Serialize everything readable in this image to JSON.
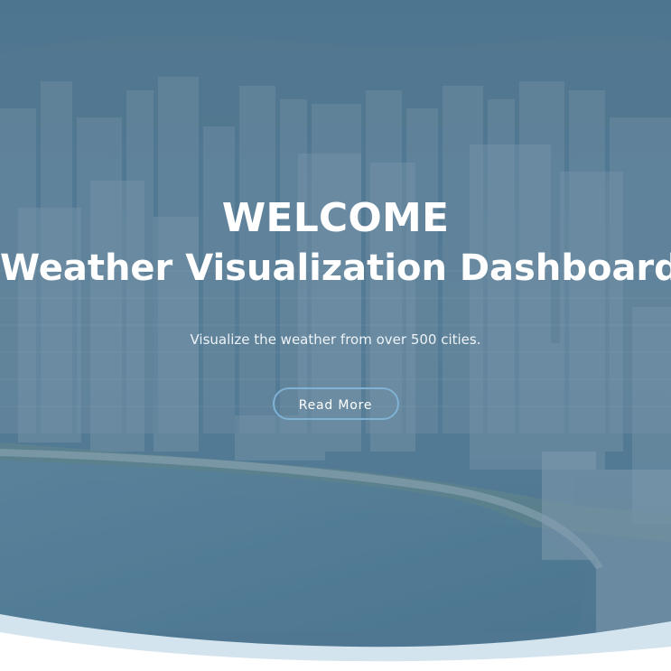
{
  "hero": {
    "title_line1": "WELCOME",
    "title_line2": "Weather Visualization Dashboard",
    "subtitle": "Visualize the weather from over 500 cities.",
    "button_label": "Read More"
  },
  "colors": {
    "overlay": "#4f7590",
    "wave_front": "#ffffff",
    "wave_back": "#d3e4ee",
    "button_border": "#7fb2d4"
  }
}
